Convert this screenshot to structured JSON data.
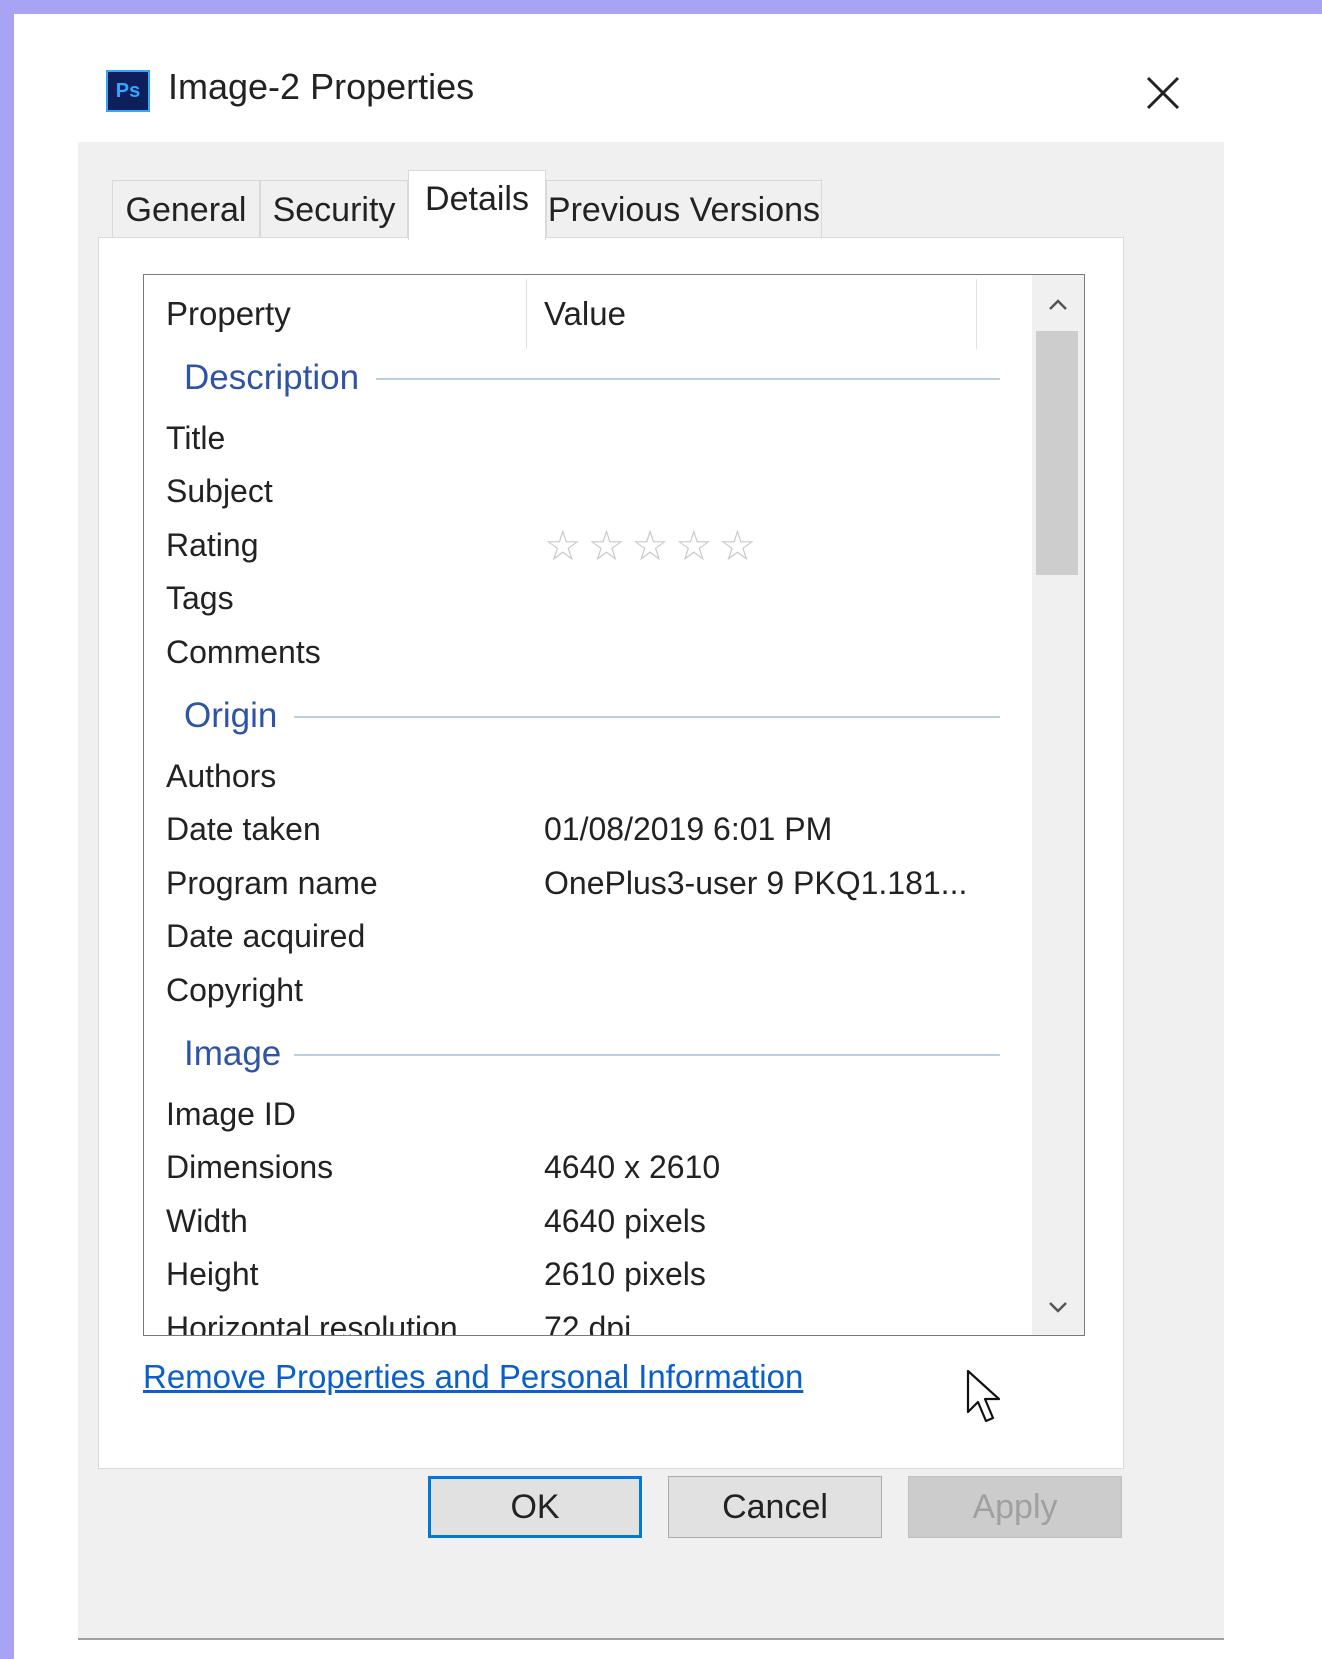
{
  "window": {
    "icon_text": "Ps",
    "title": "Image-2 Properties",
    "close_icon": "close-icon"
  },
  "tabs": [
    {
      "label": "General",
      "active": false
    },
    {
      "label": "Security",
      "active": false
    },
    {
      "label": "Details",
      "active": true
    },
    {
      "label": "Previous Versions",
      "active": false
    }
  ],
  "table": {
    "headers": {
      "property": "Property",
      "value": "Value"
    },
    "sections": [
      {
        "title": "Description",
        "rows": [
          {
            "label": "Title",
            "value": ""
          },
          {
            "label": "Subject",
            "value": ""
          },
          {
            "label": "Rating",
            "value": "",
            "stars": "☆☆☆☆☆",
            "rating": 0,
            "max_rating": 5
          },
          {
            "label": "Tags",
            "value": ""
          },
          {
            "label": "Comments",
            "value": ""
          }
        ]
      },
      {
        "title": "Origin",
        "rows": [
          {
            "label": "Authors",
            "value": ""
          },
          {
            "label": "Date taken",
            "value": "01/08/2019 6:01 PM"
          },
          {
            "label": "Program name",
            "value": "OnePlus3-user 9 PKQ1.181..."
          },
          {
            "label": "Date acquired",
            "value": ""
          },
          {
            "label": "Copyright",
            "value": ""
          }
        ]
      },
      {
        "title": "Image",
        "rows": [
          {
            "label": "Image ID",
            "value": ""
          },
          {
            "label": "Dimensions",
            "value": "4640 x 2610"
          },
          {
            "label": "Width",
            "value": "4640 pixels"
          },
          {
            "label": "Height",
            "value": "2610 pixels"
          },
          {
            "label": "Horizontal resolution",
            "value": "72 dpi"
          }
        ]
      }
    ]
  },
  "scrollbar": {
    "up_icon": "chevron-up-icon",
    "down_icon": "chevron-down-icon",
    "up_glyph": "⌃",
    "down_glyph": "⌄"
  },
  "remove_link": "Remove Properties and Personal Information",
  "buttons": {
    "ok": "OK",
    "cancel": "Cancel",
    "apply": "Apply"
  }
}
